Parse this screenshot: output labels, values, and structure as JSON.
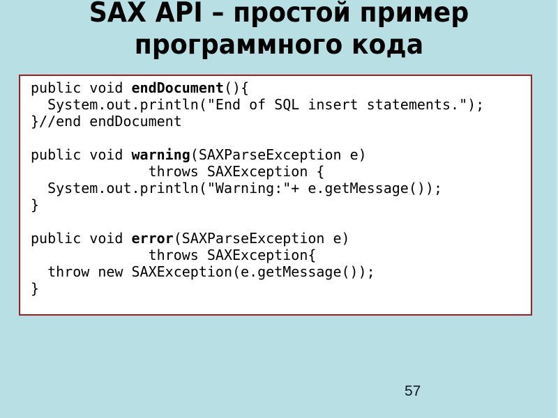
{
  "slide": {
    "title_lines": [
      "SAX API – простой пример",
      "программного кода"
    ],
    "page_number": "57",
    "colors": {
      "background": "#b8e0e4",
      "code_box_border": "#a51c20",
      "code_box_fill": "#ffffff",
      "text": "#000000"
    }
  },
  "code": {
    "lines": [
      [
        {
          "t": "public void "
        },
        {
          "t": "endDocument",
          "b": true
        },
        {
          "t": "(){"
        }
      ],
      [
        {
          "t": "  System.out.println(\"End of SQL insert statements.\");"
        }
      ],
      [
        {
          "t": "}//end endDocument"
        }
      ],
      [
        {
          "t": ""
        }
      ],
      [
        {
          "t": "public void "
        },
        {
          "t": "warning",
          "b": true
        },
        {
          "t": "(SAXParseException e)"
        }
      ],
      [
        {
          "t": "              throws SAXException {"
        }
      ],
      [
        {
          "t": "  System.out.println(\"Warning:\"+ e.getMessage());"
        }
      ],
      [
        {
          "t": "}"
        }
      ],
      [
        {
          "t": ""
        }
      ],
      [
        {
          "t": "public void "
        },
        {
          "t": "error",
          "b": true
        },
        {
          "t": "(SAXParseException e)"
        }
      ],
      [
        {
          "t": "              throws SAXException{"
        }
      ],
      [
        {
          "t": "  throw new SAXException(e.getMessage());"
        }
      ],
      [
        {
          "t": "}"
        }
      ]
    ]
  }
}
